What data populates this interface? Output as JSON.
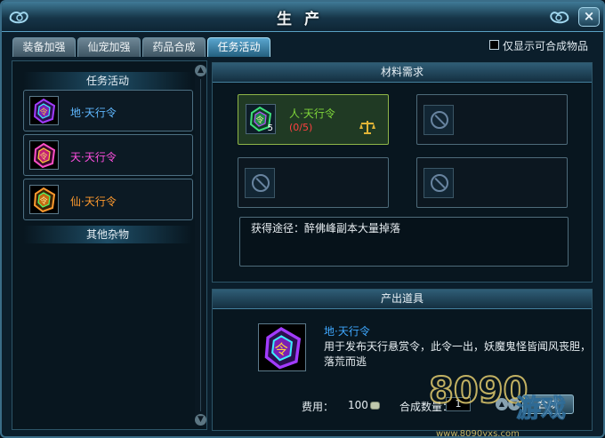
{
  "window": {
    "title": "生产",
    "close_label": "×"
  },
  "tabs": [
    {
      "label": "装备加强"
    },
    {
      "label": "仙宠加强"
    },
    {
      "label": "药品合成"
    },
    {
      "label": "任务活动"
    }
  ],
  "filter": {
    "label": "仅显示可合成物品"
  },
  "left": {
    "category_title": "任务活动",
    "items": [
      {
        "label": "地·天行令",
        "color": "#5fb8ff"
      },
      {
        "label": "天·天行令",
        "color": "#ff4fe0"
      },
      {
        "label": "仙·天行令",
        "color": "#ff9a2e"
      }
    ],
    "other_title": "其他杂物"
  },
  "materials": {
    "title": "材料需求",
    "slot1": {
      "name": "人·天行令",
      "progress": "(0/5)",
      "count": "5"
    },
    "source_text": "获得途径：醉佛峰副本大量掉落"
  },
  "output": {
    "title": "产出道具",
    "name": "地·天行令",
    "desc": "用于发布天行悬赏令，此令一出，妖魔鬼怪皆闻风丧胆，落荒而逃",
    "fee_label": "费用：",
    "fee_value": "100",
    "qty_label": "合成数量：",
    "qty_value": "1",
    "craft_label": "合成"
  },
  "watermark": {
    "logo_text": "8090",
    "brand": "游戏",
    "url": "www.8090yxs.com"
  },
  "colors": {
    "accent": "#4aa3d6",
    "selected_slot": "#8fb548",
    "progress": "#ff4040"
  }
}
